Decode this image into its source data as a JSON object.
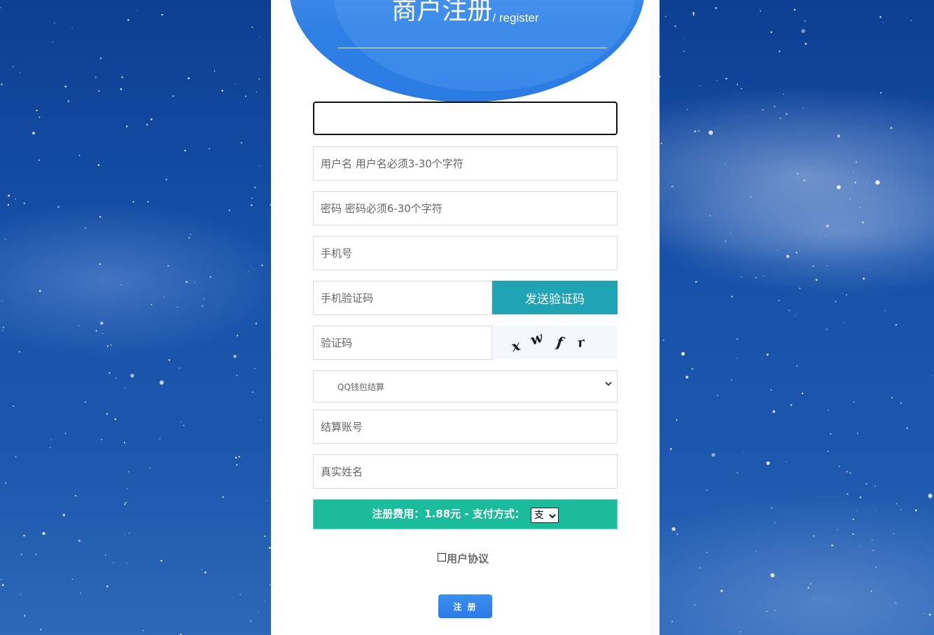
{
  "header": {
    "title": "商户注册",
    "subtitle": "/ register"
  },
  "form": {
    "top_input": {
      "value": "",
      "placeholder": ""
    },
    "username": {
      "placeholder": "用户名 用户名必须3-30个字符"
    },
    "password": {
      "placeholder": "密码 密码必须6-30个字符"
    },
    "phone": {
      "placeholder": "手机号"
    },
    "sms_code": {
      "placeholder": "手机验证码"
    },
    "send_code_label": "发送验证码",
    "captcha": {
      "placeholder": "验证码",
      "image_text": "xwfr"
    },
    "settlement_method": {
      "selected": "QQ钱包结算"
    },
    "settlement_account": {
      "placeholder": "结算账号"
    },
    "real_name": {
      "placeholder": "真实姓名"
    }
  },
  "fee": {
    "label": "注册费用：1.88元 - 支付方式：",
    "payment_selected": "支"
  },
  "agreement_label": "用户协议",
  "submit_label": "注 册",
  "colors": {
    "header_blue": "#2f80e5",
    "send_button": "#1fa3b5",
    "fee_bar": "#1abc9c",
    "submit_button": "#2b7be6",
    "background": "#1650a8"
  }
}
